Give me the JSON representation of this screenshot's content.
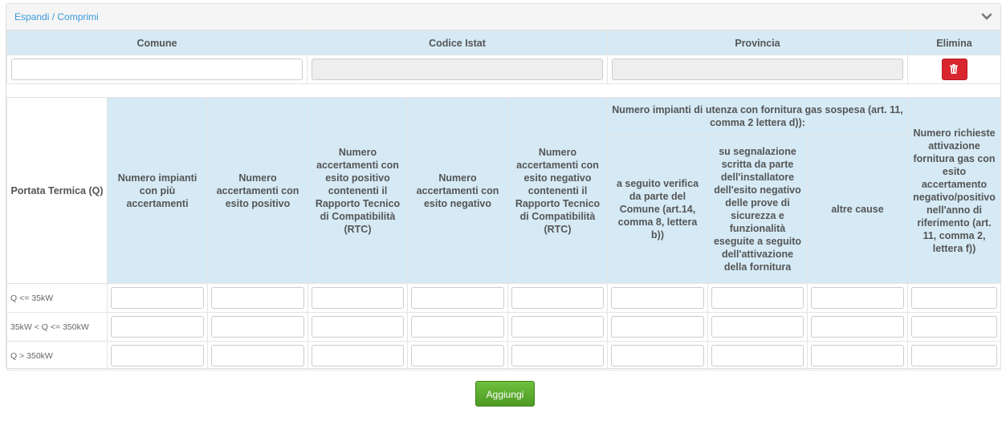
{
  "panel": {
    "toggle_label": "Espandi / Comprimi",
    "toggle_icon": "chevron-down-icon"
  },
  "comune_table": {
    "headers": [
      "Comune",
      "Codice Istat",
      "Provincia",
      "Elimina"
    ],
    "row": {
      "comune": "",
      "codice_istat": "",
      "provincia": ""
    },
    "delete_icon": "trash-icon",
    "delete_color": "#d9252e"
  },
  "accertamenti_table": {
    "col_portata": "Portata Termica (Q)",
    "col_piu_accertamenti": "Numero impianti con più accertamenti",
    "col_esito_positivo": "Numero accertamenti con esito positivo",
    "col_positivo_rtc": "Numero accertamenti con esito positivo contenenti il Rapporto Tecnico di Compatibilità (RTC)",
    "col_esito_negativo": "Numero accertamenti con esito negativo",
    "col_negativo_rtc": "Numero accertamenti con esito negativo contenenti il Rapporto Tecnico di Compatibilità (RTC)",
    "group_sospesa": "Numero impianti di utenza con fornitura gas sospesa (art. 11, comma 2 lettera d)):",
    "sub_verifica_comune": "a seguito verifica da parte del Comune (art.14, comma 8, lettera b))",
    "sub_segnalazione": "su segnalazione scritta da parte dell'installatore dell'esito negativo delle prove di sicurezza e funzionalità eseguite a seguito dell'attivazione della fornitura",
    "sub_altre_cause": "altre cause",
    "col_richieste": "Numero richieste attivazione fornitura gas con esito accertamento negativo/positivo nell'anno di riferimento (art. 11, comma 2, lettera f))",
    "rows": [
      "Q <= 35kW",
      "35kW < Q <= 350kW",
      "Q > 350kW"
    ]
  },
  "add_button": {
    "label": "Aggiungi",
    "color": "#5cad30"
  },
  "colors": {
    "header_bg": "#d5eaf5",
    "link": "#3a9ad9"
  }
}
